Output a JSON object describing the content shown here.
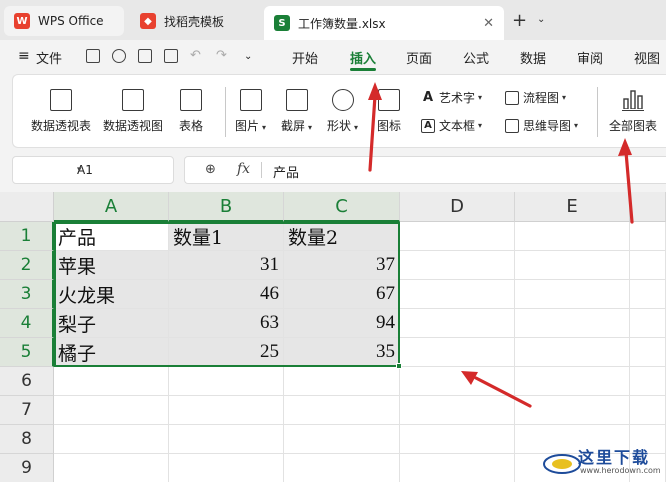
{
  "tabs": [
    {
      "label": "WPS Office",
      "icon": "wps-logo-icon",
      "color": "#e8412f"
    },
    {
      "label": "找稻壳模板",
      "icon": "docer-logo-icon",
      "color": "#e8412f"
    },
    {
      "label": "工作簿数量.xlsx",
      "icon": "sheet-logo-icon",
      "color": "#1a7f37"
    }
  ],
  "menubar": {
    "file_label": "文件",
    "items": [
      "开始",
      "插入",
      "页面",
      "公式",
      "数据",
      "审阅",
      "视图"
    ],
    "active": "插入"
  },
  "ribbon": {
    "pivot_table": "数据透视表",
    "pivot_chart": "数据透视图",
    "table": "表格",
    "picture": "图片",
    "screenshot": "截屏",
    "shape": "形状",
    "icon": "图标",
    "wordart": "艺术字",
    "textbox": "文本框",
    "flowchart": "流程图",
    "mindmap": "思维导图",
    "all_charts": "全部图表"
  },
  "formula": {
    "cell_ref": "A1",
    "content": "产品",
    "fx": "fx"
  },
  "grid": {
    "columns": [
      "A",
      "B",
      "C",
      "D",
      "E"
    ],
    "rows": [
      "1",
      "2",
      "3",
      "4",
      "5",
      "6",
      "7",
      "8",
      "9"
    ],
    "data": [
      [
        "产品",
        "数量1",
        "数量2"
      ],
      [
        "苹果",
        "31",
        "37"
      ],
      [
        "火龙果",
        "46",
        "67"
      ],
      [
        "梨子",
        "63",
        "94"
      ],
      [
        "橘子",
        "25",
        "35"
      ]
    ]
  },
  "watermark": {
    "text": "这里下载",
    "url": "www.herodown.com"
  },
  "colors": {
    "accent": "#1a7f37",
    "arrow": "#d42a2a"
  }
}
